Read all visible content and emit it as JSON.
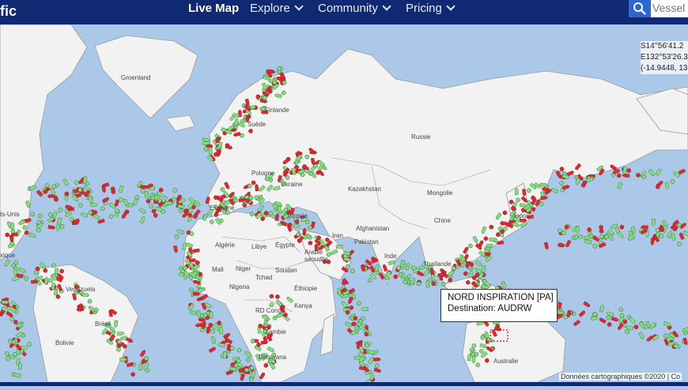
{
  "header": {
    "brand_fragment": "fic",
    "nav": [
      {
        "label": "Live Map",
        "active": true
      },
      {
        "label": "Explore",
        "dropdown": true
      },
      {
        "label": "Community",
        "dropdown": true
      },
      {
        "label": "Pricing",
        "dropdown": true
      }
    ],
    "search_placeholder": "Vessel"
  },
  "coordinates": {
    "lat": "S14°56'41.2",
    "lon": "E132°53'26.3",
    "decimal": "(-14.9448, 13"
  },
  "tooltip": {
    "vessel": "NORD INSPIRATION [PA]",
    "destination": "Destination: AUDRW"
  },
  "attribution": "Données cartographiques ©2020",
  "attribution_suffix": "Co",
  "map_labels": {
    "groenland": "Groenland",
    "finlande": "Finlande",
    "suede": "Suède",
    "russie": "Russie",
    "pologne": "Pologne",
    "ukraine": "Ukraine",
    "kazakhstan": "Kazakhstan",
    "mongolie": "Mongolie",
    "espagne": "Espagne",
    "turquie": "Turquie",
    "afghanistan": "Afghanistan",
    "chine": "Chine",
    "japon": "Japon",
    "iran": "Iran",
    "pakistan": "Pakistan",
    "inde": "Inde",
    "algerie": "Algérie",
    "libye": "Libye",
    "egypte": "Égypte",
    "arabie": "Arabie",
    "saoudite": "saoudite",
    "thailande": "Thaïlande",
    "mali": "Mali",
    "niger": "Niger",
    "tchad": "Tchad",
    "soudan": "Soudan",
    "ethiopie": "Éthiopie",
    "nigeria": "Nigeria",
    "kenya": "Kenya",
    "rdcongo": "RD Congo",
    "zambie": "Zambie",
    "botswana": "Botswana",
    "venezuela": "Venezuela",
    "bresil": "Brésil",
    "bolivie": "Bolivie",
    "mexique": "xique",
    "etatsunis": "ts-Unis",
    "australie": "Australie"
  },
  "colors": {
    "header": "#0f2a73",
    "ocean": "#abc8e8",
    "land": "#f2f2f2",
    "vessel_cargo": "#7ee07a",
    "vessel_tanker": "#e8242a",
    "search_button": "#2e66d8"
  }
}
